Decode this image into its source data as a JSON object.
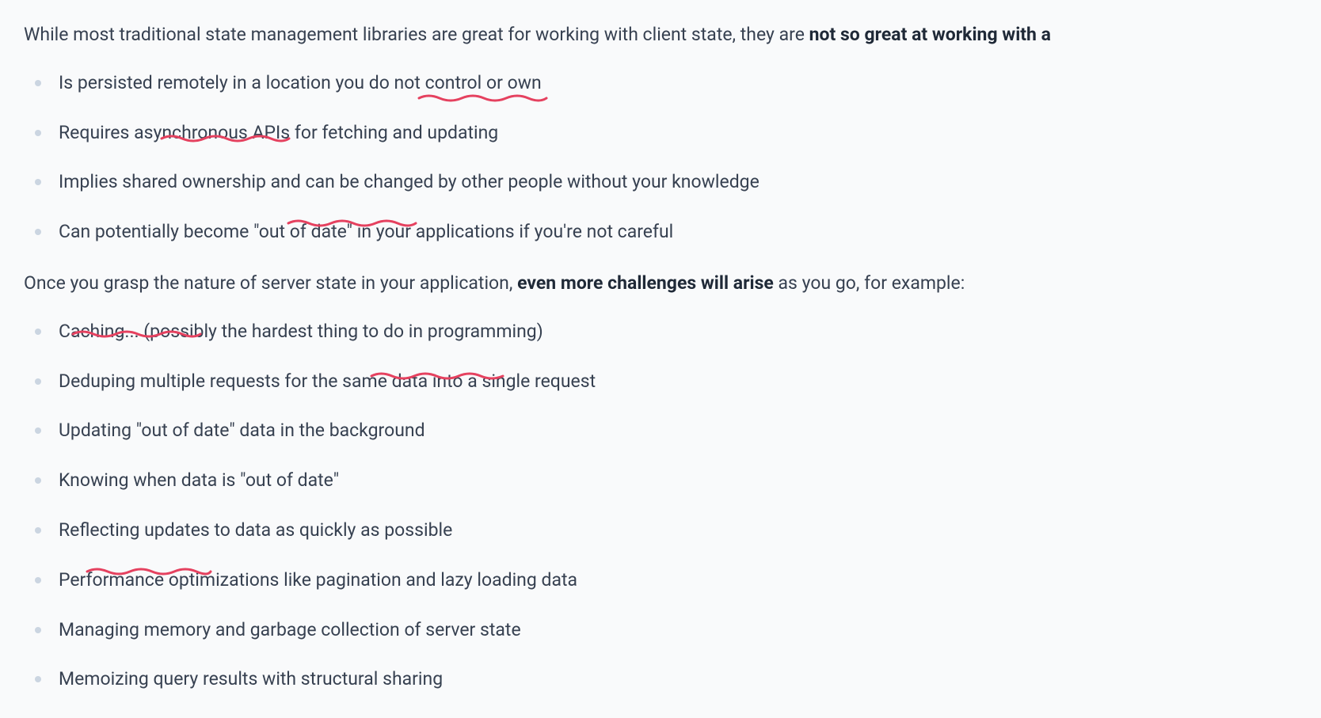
{
  "intro": {
    "text_before": "While most traditional state management libraries are great for working with client state, they are ",
    "bold": "not so great at working with a"
  },
  "list1": [
    "Is persisted remotely in a location you do not control or own",
    "Requires asynchronous APIs for fetching and updating",
    "Implies shared ownership and can be changed by other people without your knowledge",
    "Can potentially become \"out of date\" in your applications if you're not careful"
  ],
  "middle": {
    "text_before": "Once you grasp the nature of server state in your application, ",
    "bold": "even more challenges will arise",
    "text_after": " as you go, for example:"
  },
  "list2": [
    "Caching... (possibly the hardest thing to do in programming)",
    "Deduping multiple requests for the same data into a single request",
    "Updating \"out of date\" data in the background",
    "Knowing when data is \"out of date\"",
    "Reflecting updates to data as quickly as possible",
    "Performance optimizations like pagination and lazy loading data",
    "Managing memory and garbage collection of server state",
    "Memoizing query results with structural sharing"
  ],
  "squiggle_color": "#e5415f"
}
